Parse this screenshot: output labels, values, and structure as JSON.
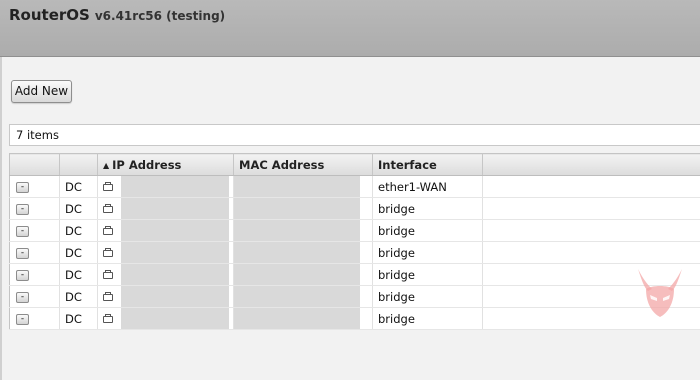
{
  "window": {
    "brand": "RouterOS",
    "version": "v6.41rc56 (testing)"
  },
  "toolbar": {
    "add_new_label": "Add New"
  },
  "list": {
    "count_text": "7 items"
  },
  "table": {
    "columns": {
      "ip_address": "IP Address",
      "mac_address": "MAC Address",
      "interface": "Interface"
    },
    "sort_indicator": "▲",
    "rows": [
      {
        "button": "-",
        "flags": "DC",
        "interface": "ether1-WAN"
      },
      {
        "button": "-",
        "flags": "DC",
        "interface": "bridge"
      },
      {
        "button": "-",
        "flags": "DC",
        "interface": "bridge"
      },
      {
        "button": "-",
        "flags": "DC",
        "interface": "bridge"
      },
      {
        "button": "-",
        "flags": "DC",
        "interface": "bridge"
      },
      {
        "button": "-",
        "flags": "DC",
        "interface": "bridge"
      },
      {
        "button": "-",
        "flags": "DC",
        "interface": "bridge"
      }
    ]
  },
  "icons": {
    "address_entry": "address-entry-icon",
    "watermark": "horned-mask-logo"
  },
  "colors": {
    "title_bar": "#b4b4b4",
    "redaction": "#d9d9d9",
    "watermark": "#f3a7a7"
  }
}
